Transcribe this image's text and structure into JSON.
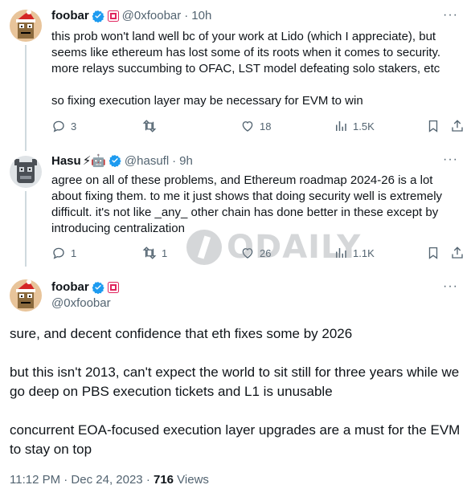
{
  "tweets": [
    {
      "name": "foobar",
      "handle": "@0xfoobar",
      "separator": "·",
      "time": "10h",
      "body": [
        "this prob won't land well bc of your work at Lido (which I appreciate), but seems like ethereum has lost some of its roots when it comes to security. more relays succumbing to OFAC, LST model defeating solo stakers, etc",
        "so fixing execution layer may be necessary for EVM to win"
      ],
      "actions": {
        "replies": "3",
        "retweets": "",
        "likes": "18",
        "views": "1.5K"
      }
    },
    {
      "name": "Hasu",
      "name_emoji": "⚡🤖",
      "handle": "@hasufl",
      "separator": "·",
      "time": "9h",
      "body": [
        "agree on all of these problems, and Ethereum roadmap 2024-26 is a lot about fixing them. to me it just shows that doing security well is extremely difficult. it's not like _any_ other chain has done better in these except by introducing centralization"
      ],
      "actions": {
        "replies": "1",
        "retweets": "1",
        "likes": "26",
        "views": "1.1K"
      }
    }
  ],
  "main_tweet": {
    "name": "foobar",
    "handle": "@0xfoobar",
    "paragraphs": [
      "sure, and decent confidence that eth fixes some by 2026",
      "but this isn't 2013, can't expect the world to sit still for three years while we go deep on PBS execution tickets and L1 is unusable",
      "concurrent EOA-focused execution layer upgrades are a must for the EVM to stay on top"
    ],
    "timestamp": "11:12 PM · Dec 24, 2023 · ",
    "views_count": "716",
    "views_label": " Views"
  },
  "more_label": "···",
  "watermark": "ODAILY",
  "colors": {
    "text": "#0f1419",
    "muted": "#536471",
    "verified": "#1d9bf0",
    "line": "#cfd9de"
  },
  "icons": [
    "reply-icon",
    "retweet-icon",
    "like-icon",
    "views-icon",
    "bookmark-icon",
    "share-icon",
    "verified-icon",
    "more-icon"
  ]
}
